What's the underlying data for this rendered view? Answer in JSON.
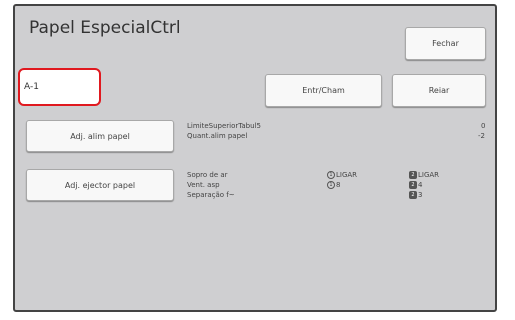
{
  "window": {
    "title": "Papel EspecialCtrl"
  },
  "toolbar": {
    "close_label": "Fechar",
    "entry_label": "Entr/Cham",
    "reset_label": "Reiar"
  },
  "entry": {
    "name": "A-1"
  },
  "feed_section": {
    "button_label": "Adj. alim papel",
    "line1_label": "LimiteSuperiorTabul5",
    "line1_value": "0",
    "line2_label": "Quant.alim papel",
    "line2_value": "-2"
  },
  "eject_section": {
    "button_label": "Adj. ejector papel",
    "labels": [
      "Sopro de ar",
      "Vent. asp",
      "Separação f~"
    ],
    "col1": [
      {
        "icon": "1",
        "value": "LIGAR"
      },
      {
        "icon": "1",
        "value": "8"
      }
    ],
    "col2": [
      {
        "icon": "2",
        "value": "LIGAR"
      },
      {
        "icon": "2",
        "value": "4"
      },
      {
        "icon": "2",
        "value": "3"
      }
    ]
  },
  "colors": {
    "panel": "#cfcfd1",
    "highlight": "#e0191f",
    "button": "#f8f8f8"
  }
}
